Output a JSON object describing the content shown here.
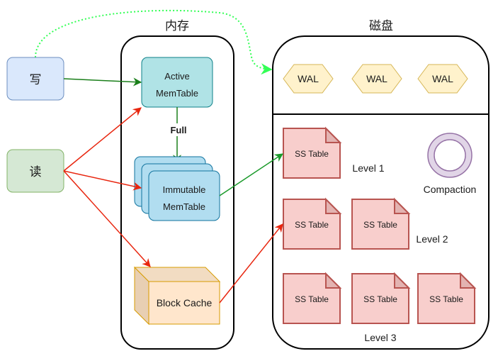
{
  "labels": {
    "memory_title": "内存",
    "disk_title": "磁盘",
    "write": "写",
    "read": "读",
    "active_memtable_line1": "Active",
    "active_memtable_line2": "MemTable",
    "full": "Full",
    "immutable_line1": "Immutable",
    "immutable_line2": "MemTable",
    "block_cache": "Block Cache",
    "wal": [
      "WAL",
      "WAL",
      "WAL"
    ],
    "sstable": "SS Table",
    "level1": "Level 1",
    "level2": "Level 2",
    "level3": "Level 3",
    "compaction": "Compaction"
  },
  "colors": {
    "write_fill": "#dae8fc",
    "write_stroke": "#6c8ebf",
    "read_fill": "#d5e8d4",
    "read_stroke": "#82b366",
    "active_fill": "#b0e3e6",
    "active_stroke": "#0e8088",
    "immutable_fill": "#b1ddf0",
    "immutable_stroke": "#10739e",
    "cache_fill": "#ffe6cc",
    "cache_stroke": "#d79b00",
    "wal_fill": "#fff2cc",
    "wal_stroke": "#d6b656",
    "sstable_fill": "#f8cecc",
    "sstable_stroke": "#b85450",
    "compaction_fill": "#e1d5e7",
    "compaction_stroke": "#9673a6",
    "green_arrow": "#1a7f1a",
    "red_arrow": "#e8260f",
    "dotted_arrow": "#33ff55"
  }
}
